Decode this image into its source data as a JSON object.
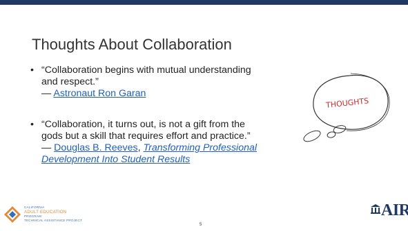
{
  "slide": {
    "title": "Thoughts About Collaboration",
    "bullets": [
      {
        "quote_l1": "“Collaboration begins with mutual understanding",
        "quote_l2": "and respect.”",
        "dash": "— ",
        "author": "Astronaut Ron Garan"
      },
      {
        "quote_l1": " “Collaboration, it turns out, is not a gift from the",
        "quote_l2": "gods but a skill that requires effort and practice.”",
        "dash": "— ",
        "author": "Douglas B. Reeves",
        "sep": ", ",
        "source_l1": "Transforming Professional",
        "source_l2": "Development Into Student Results"
      }
    ],
    "bubble_text": "THOUGHTS",
    "page_number": "5"
  },
  "footer": {
    "line1": "CALIFORNIA",
    "line2": "ADULT EDUCATION",
    "line3": "PROGRAM",
    "line4": "TECHNICAL ASSISTANCE PROJECT",
    "air_logo": "AIR"
  },
  "colors": {
    "topbar": "#1f3864",
    "link": "#1f5fbf",
    "footer_orange": "#e08a3c",
    "footer_blue": "#3a6fb5"
  }
}
